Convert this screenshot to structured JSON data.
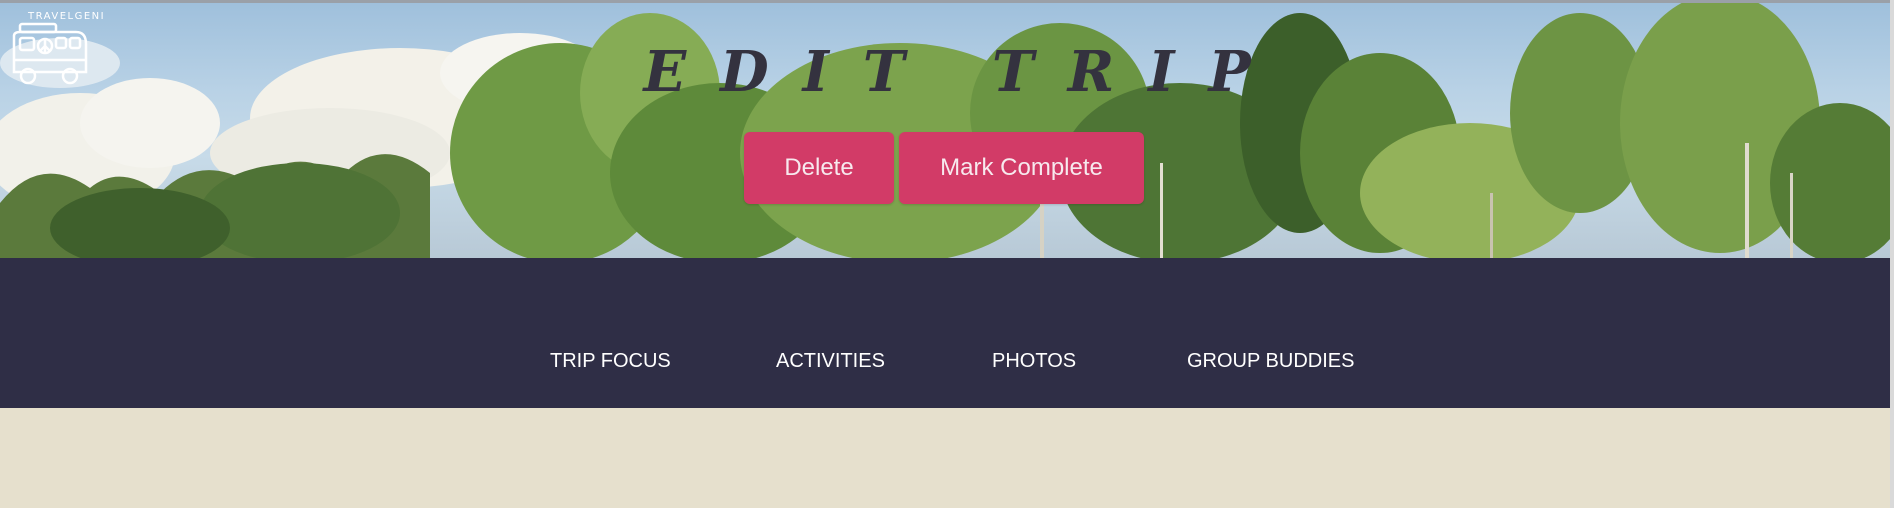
{
  "app": {
    "logo_text": "TRAVELGENI"
  },
  "header": {
    "title": "EDIT TRIP",
    "delete_label": "Delete",
    "complete_label": "Mark Complete"
  },
  "nav": {
    "items": [
      {
        "label": "TRIP FOCUS"
      },
      {
        "label": "ACTIVITIES"
      },
      {
        "label": "PHOTOS"
      },
      {
        "label": "GROUP BUDDIES"
      }
    ]
  },
  "colors": {
    "accent_button": "#d23b67",
    "nav_background": "#2f2e46",
    "page_background": "#e6e0cd",
    "title_text": "#34323f"
  },
  "icons": {
    "logo": "camper-van-icon"
  }
}
